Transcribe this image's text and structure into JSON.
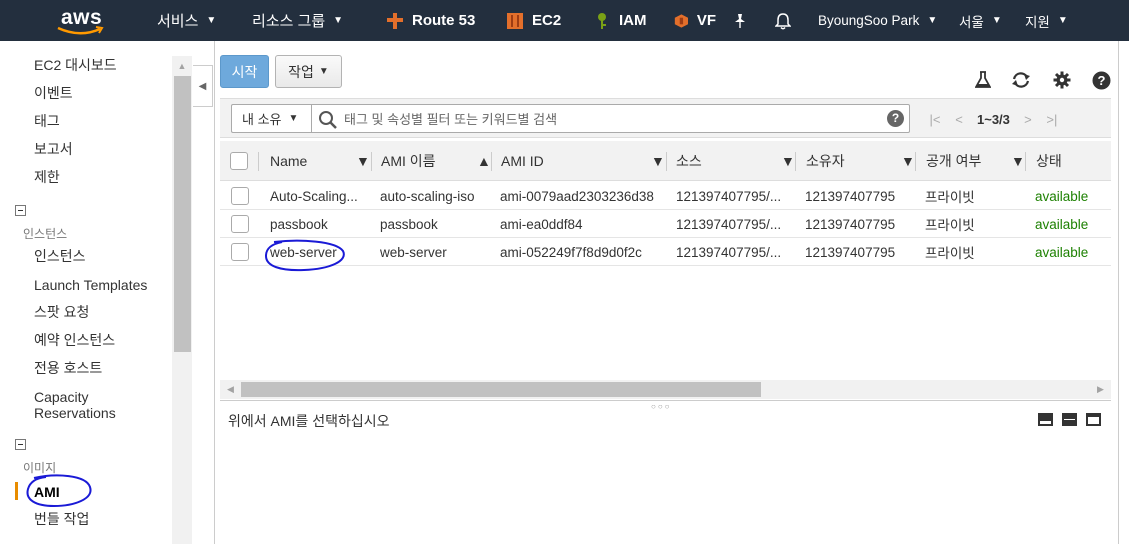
{
  "topnav": {
    "logo_text": "aws",
    "services": "서비스",
    "resource_groups": "리소스 그룹",
    "route53": "Route 53",
    "ec2": "EC2",
    "iam": "IAM",
    "vpc": "VF",
    "user": "ByoungSoo Park",
    "region": "서울",
    "support": "지원"
  },
  "sidebar": {
    "items": [
      {
        "label": "EC2 대시보드"
      },
      {
        "label": "이벤트"
      },
      {
        "label": "태그"
      },
      {
        "label": "보고서"
      },
      {
        "label": "제한"
      }
    ],
    "instances_group": "인스턴스",
    "instances_items": [
      {
        "label": "인스턴스"
      },
      {
        "label": "Launch Templates"
      },
      {
        "label": "스팟 요청"
      },
      {
        "label": "예약 인스턴스"
      },
      {
        "label": "전용 호스트"
      },
      {
        "label": "Capacity"
      },
      {
        "label": "Reservations"
      }
    ],
    "images_group": "이미지",
    "images_items": [
      {
        "label": "AMI",
        "active": true
      },
      {
        "label": "번들 작업"
      }
    ]
  },
  "toolbar": {
    "launch_label": "시작",
    "actions_label": "작업"
  },
  "filter": {
    "owner": "내 소유",
    "placeholder": "태그 및 속성별 필터 또는 키워드별 검색",
    "pagination": "1~3/3"
  },
  "table": {
    "headers": [
      "Name",
      "AMI 이름",
      "AMI ID",
      "소스",
      "소유자",
      "공개 여부",
      "상태"
    ],
    "rows": [
      {
        "name": "Auto-Scaling...",
        "ami_name": "auto-scaling-iso",
        "ami_id": "ami-0079aad2303236d38",
        "source": "121397407795/...",
        "owner": "121397407795",
        "visibility": "프라이빗",
        "status": "available"
      },
      {
        "name": "passbook",
        "ami_name": "passbook",
        "ami_id": "ami-ea0ddf84",
        "source": "121397407795/...",
        "owner": "121397407795",
        "visibility": "프라이빗",
        "status": "available"
      },
      {
        "name": "web-server",
        "ami_name": "web-server",
        "ami_id": "ami-052249f7f8d9d0f2c",
        "source": "121397407795/...",
        "owner": "121397407795",
        "visibility": "프라이빗",
        "status": "available"
      }
    ]
  },
  "detail": {
    "message": "위에서 AMI를 선택하십시오"
  },
  "colors": {
    "nav_bg": "#232f3e",
    "primary_button": "#6ea9dc",
    "status_available": "#1d8102",
    "active_marker": "#e88c00",
    "annotation_ink": "#1a1ad6"
  }
}
